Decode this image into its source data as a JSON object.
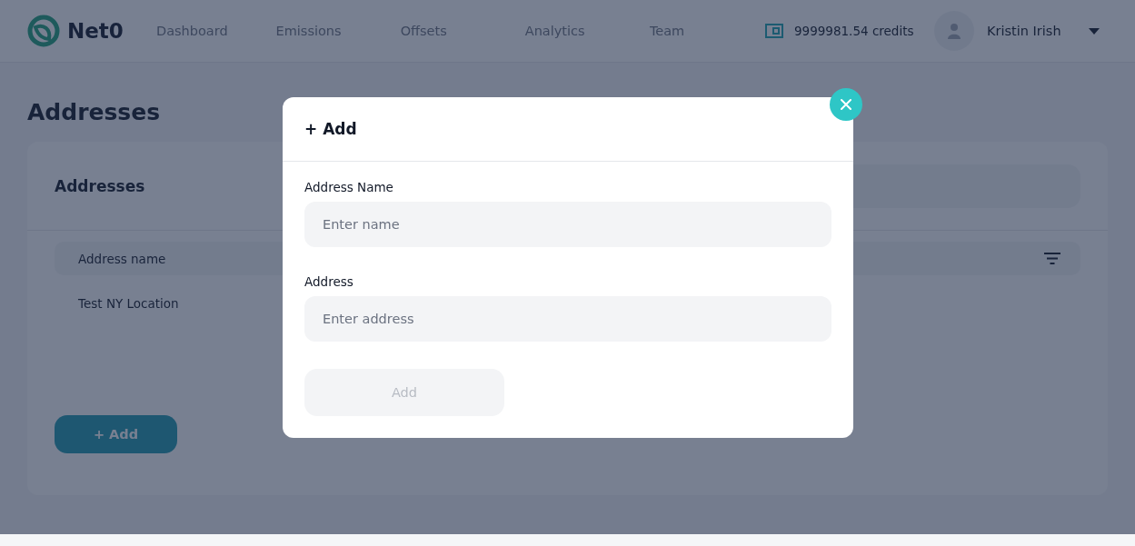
{
  "header": {
    "brand": "Net0",
    "nav": [
      "Dashboard",
      "Emissions",
      "Offsets",
      "Analytics",
      "Team"
    ],
    "credits": "9999981.54 credits",
    "user": "Kristin Irish"
  },
  "page": {
    "title": "Addresses"
  },
  "card": {
    "title": "Addresses",
    "table": {
      "columns": [
        "Address name"
      ],
      "rows": [
        [
          "Test NY Location"
        ]
      ]
    },
    "add_button": "+ Add"
  },
  "modal": {
    "title": "+ Add",
    "fields": [
      {
        "label": "Address Name",
        "placeholder": "Enter name"
      },
      {
        "label": "Address",
        "placeholder": "Enter address"
      }
    ],
    "submit": {
      "label": "Add",
      "disabled": true
    }
  }
}
